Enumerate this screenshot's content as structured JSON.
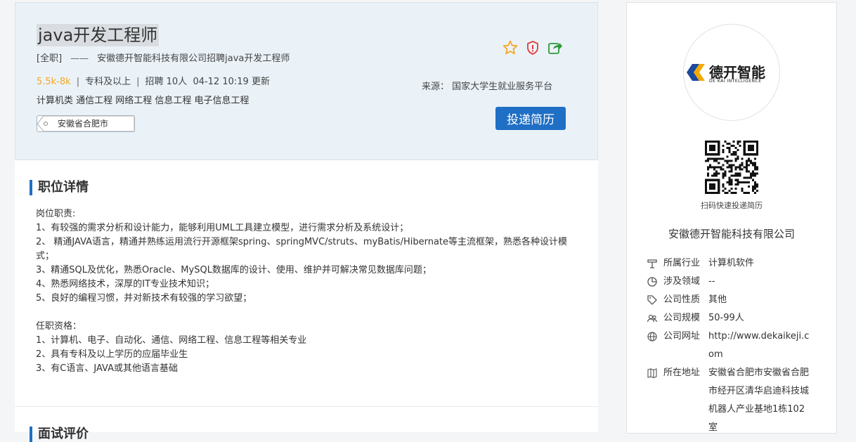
{
  "job": {
    "title": "java开发工程师",
    "type": "[全职]",
    "dash": "——",
    "recruit_line": "安徽德开智能科技有限公司招聘java开发工程师",
    "salary": "5.5k-8k",
    "education": "专科及以上",
    "headcount": "招聘 10人",
    "updated": "04-12 10:19 更新",
    "majors": "计算机类 通信工程 网络工程 信息工程 电子信息工程",
    "location": "安徽省合肥市",
    "source": "来源： 国家大学生就业服务平台",
    "apply_label": "投递简历",
    "icons": [
      "star-icon",
      "report-shield-icon",
      "share-icon"
    ]
  },
  "detail": {
    "section_title": "职位详情",
    "lines": [
      "岗位职责:",
      "1、有较强的需求分析和设计能力，能够利用UML工具建立模型，进行需求分析及系统设计；",
      "2、 精通JAVA语言，精通并熟练运用流行开源框架spring、springMVC/struts、myBatis/Hibernate等主流框架，熟悉各种设计模式；",
      "3、精通SQL及优化，熟悉Oracle、MySQL数据库的设计、使用、维护并可解决常见数据库问题；",
      "4、熟悉网络技术，深厚的IT专业技术知识；",
      "5、良好的编程习惯，并对新技术有较强的学习欲望；",
      "",
      "任职资格：",
      "1、计算机、电子、自动化、通信、网络工程、信息工程等相关专业",
      "2、具有专科及以上学历的应届毕业生",
      "3、有C语言、JAVA或其他语言基础"
    ],
    "next_section_title": "面试评价"
  },
  "company": {
    "logo_text": "德开智能",
    "logo_subtext": "DE KAI INTELLIGENCE",
    "qr_caption": "扫码快速投递简历",
    "name": "安徽德开智能科技有限公司",
    "info": [
      {
        "label": "所属行业",
        "value": "计算机软件",
        "icon": "industry-icon"
      },
      {
        "label": "涉及领域",
        "value": "--",
        "icon": "pie-chart-icon"
      },
      {
        "label": "公司性质",
        "value": "其他",
        "icon": "tag-icon"
      },
      {
        "label": "公司规模",
        "value": "50-99人",
        "icon": "people-icon"
      },
      {
        "label": "公司网址",
        "value": "http://www.dekaikeji.com",
        "icon": "globe-icon"
      },
      {
        "label": "所在地址",
        "value": "安徽省合肥市安徽省合肥市经开区清华启迪科技城机器人产业基地1栋102室",
        "icon": "map-icon"
      }
    ]
  },
  "colors": {
    "accent": "#1f6fc5",
    "salary": "#f5a623",
    "star": "#f5a623",
    "report": "#e23b3b",
    "share": "#2e9a3a",
    "header_bg": "#eaf2f8"
  }
}
